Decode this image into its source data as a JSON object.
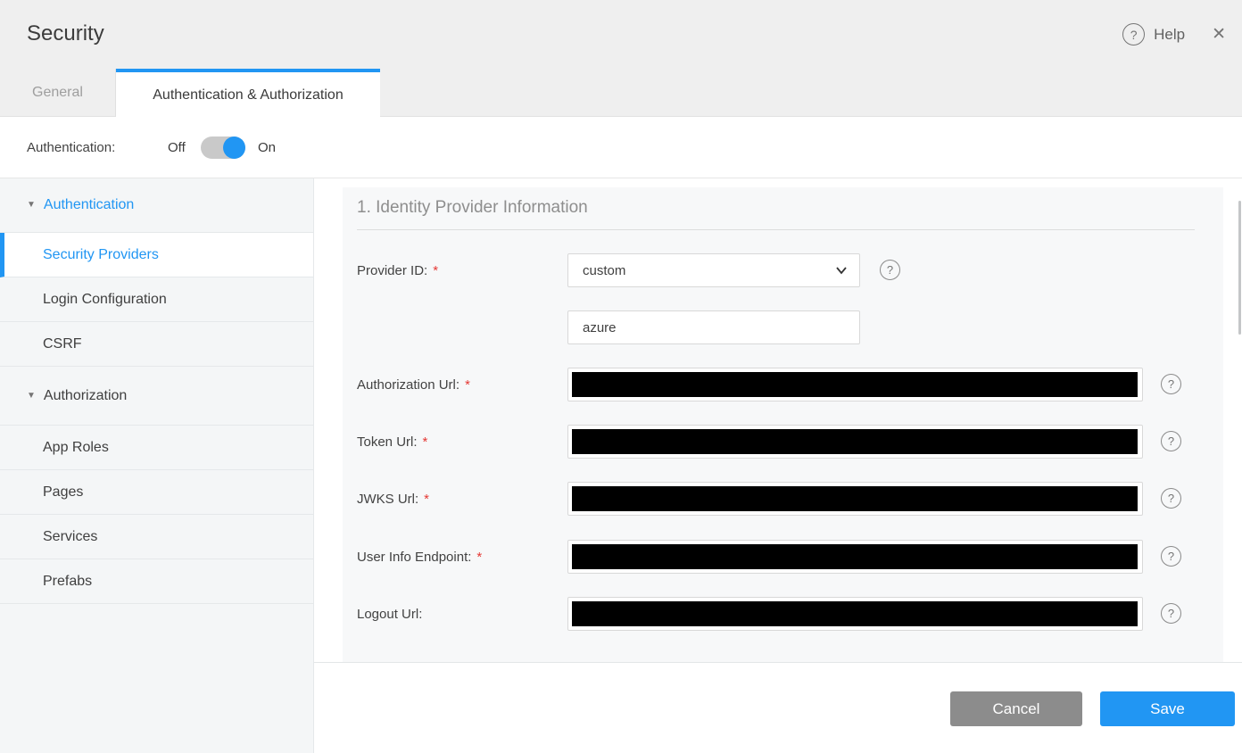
{
  "window": {
    "title": "Security",
    "help_label": "Help"
  },
  "icons": {
    "help": "?",
    "close": "✕",
    "triangle_down": "▼"
  },
  "tabs": [
    {
      "label": "General",
      "active": false
    },
    {
      "label": "Authentication & Authorization",
      "active": true
    }
  ],
  "auth_toggle": {
    "label": "Authentication:",
    "off": "Off",
    "on": "On",
    "state": "On"
  },
  "sidebar": {
    "items": [
      {
        "label": "Authentication",
        "type": "group",
        "expanded": true
      },
      {
        "label": "Security Providers",
        "selected": true
      },
      {
        "label": "Login Configuration"
      },
      {
        "label": "CSRF"
      },
      {
        "label": "Authorization",
        "type": "group",
        "expanded": true
      },
      {
        "label": "App Roles"
      },
      {
        "label": "Pages"
      },
      {
        "label": "Services"
      },
      {
        "label": "Prefabs"
      }
    ]
  },
  "form": {
    "section_title": "1. Identity Provider Information",
    "required_marker": "*",
    "provider_id": {
      "label": "Provider ID:",
      "required": true,
      "selected_value": "custom",
      "custom_value": "azure"
    },
    "fields": [
      {
        "label": "Authorization Url:",
        "required": true,
        "value_redacted": true
      },
      {
        "label": "Token Url:",
        "required": true,
        "value_redacted": true
      },
      {
        "label": "JWKS Url:",
        "required": true,
        "value_redacted": true
      },
      {
        "label": "User Info Endpoint:",
        "required": true,
        "value_redacted": true
      },
      {
        "label": "Logout Url:",
        "required": false,
        "value_redacted": true
      }
    ]
  },
  "footer": {
    "cancel_label": "Cancel",
    "save_label": "Save"
  },
  "colors": {
    "accent": "#2196f3",
    "cancel_gray": "#8c8c8c",
    "required_red": "#e53935",
    "redaction": "#000000"
  }
}
